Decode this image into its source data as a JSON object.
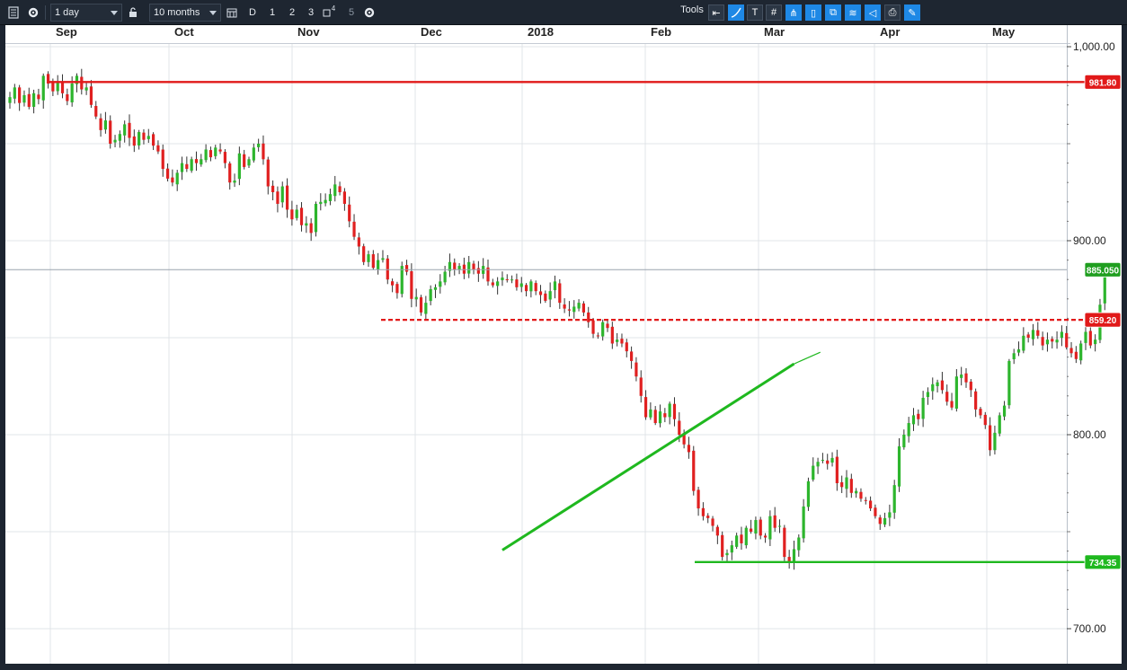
{
  "toolbar": {
    "interval": "1 day",
    "range": "10 months",
    "period_d": "D",
    "period_1": "1",
    "period_2": "2",
    "period_3": "3",
    "period_4_sup": "4",
    "period_5": "5",
    "tools_label": "Tools"
  },
  "colors": {
    "up": "#2db52d",
    "down": "#e02020",
    "resistance": "#e11919",
    "support": "#1fb81f",
    "last": "#1f9e1f",
    "grid": "#e1e4e8",
    "axis_text": "#222222"
  },
  "chart_data": {
    "type": "candlestick",
    "x_labels": [
      "Sep",
      "Oct",
      "Nov",
      "Dec",
      "2018",
      "Feb",
      "Mar",
      "Apr",
      "May"
    ],
    "y_ticks": [
      "1,000.00",
      "900.00",
      "800.00",
      "700.00"
    ],
    "y_tick_values": [
      1000,
      900,
      800,
      700
    ],
    "ylim": [
      690,
      1000
    ],
    "last_price": "885.050",
    "levels": [
      {
        "label": "981.80",
        "value": 981.8,
        "style": "solid",
        "color": "#e11919"
      },
      {
        "label": "859.20",
        "value": 859.2,
        "style": "dashed",
        "color": "#e11919"
      },
      {
        "label": "734.35",
        "value": 734.35,
        "style": "solid",
        "color": "#1fb81f"
      }
    ],
    "trendline": {
      "start": [
        103,
        740.5
      ],
      "end": [
        164,
        836.5
      ],
      "extension": [
        168,
        842.5
      ]
    },
    "closes": [
      974,
      979,
      971,
      975,
      969,
      976,
      973,
      985,
      981,
      977,
      982,
      976,
      972,
      981,
      985,
      978,
      979,
      970,
      964,
      957,
      962,
      950,
      952,
      955,
      960,
      953,
      949,
      956,
      952,
      954,
      949,
      946,
      937,
      932,
      930,
      935,
      940,
      937,
      942,
      940,
      942,
      947,
      943,
      948,
      946,
      940,
      930,
      931,
      945,
      938,
      942,
      948,
      950,
      942,
      928,
      925,
      919,
      928,
      916,
      911,
      916,
      908,
      909,
      904,
      919,
      920,
      921,
      924,
      929,
      925,
      919,
      910,
      902,
      897,
      889,
      893,
      886,
      890,
      891,
      880,
      877,
      873,
      887,
      884,
      870,
      871,
      863,
      868,
      875,
      876,
      879,
      884,
      889,
      885,
      887,
      883,
      889,
      885,
      883,
      887,
      879,
      877,
      879,
      881,
      880,
      880,
      876,
      878,
      874,
      879,
      874,
      872,
      869,
      874,
      879,
      868,
      865,
      864,
      866,
      868,
      863,
      858,
      852,
      851,
      858,
      855,
      847,
      849,
      847,
      843,
      838,
      830,
      820,
      809,
      813,
      806,
      812,
      809,
      816,
      808,
      800,
      795,
      791,
      771,
      762,
      758,
      757,
      753,
      748,
      737,
      739,
      743,
      748,
      744,
      752,
      750,
      756,
      748,
      747,
      758,
      752,
      753,
      737,
      734,
      741,
      747,
      763,
      776,
      784,
      786,
      787,
      785,
      788,
      775,
      773,
      778,
      770,
      771,
      767,
      766,
      762,
      758,
      754,
      757,
      760,
      774,
      794,
      800,
      806,
      810,
      808,
      819,
      822,
      826,
      827,
      823,
      817,
      814,
      830,
      831,
      827,
      823,
      813,
      810,
      805,
      792,
      801,
      810,
      815,
      838,
      842,
      844,
      851,
      850,
      854,
      851,
      846,
      849,
      848,
      849,
      853,
      845,
      842,
      839,
      847,
      853,
      846,
      849,
      867,
      885,
      886
    ]
  }
}
